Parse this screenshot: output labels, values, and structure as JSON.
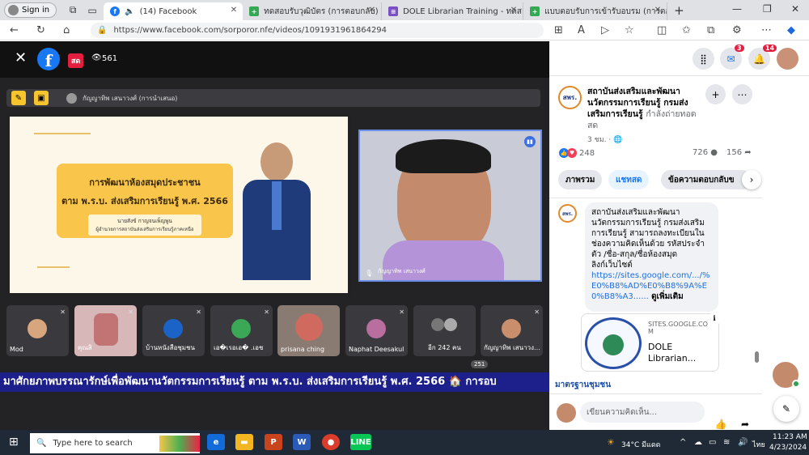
{
  "browser": {
    "signin_label": "Sign in",
    "tabs": [
      {
        "title": "(14) Facebook",
        "active": true
      },
      {
        "title": "ทดสอบรับวุฒิบัตร (การตอบกลับ) - Goo"
      },
      {
        "title": "DOLE Librarian Training - ทดสอบ"
      },
      {
        "title": "แบบตอบรับการเข้ารับอบรม (การตอบ"
      }
    ],
    "new_tab": "+",
    "url": "https://www.facebook.com/sorporor.nfe/videos/1091931961864294"
  },
  "video": {
    "live_badge": "สด",
    "viewers": "561",
    "presenter_bar": "กัญญาทิพ เสนาวงศ์ (การนำเสนอ)",
    "slide": {
      "title_line1": "การพัฒนาห้องสมุดประชาชน",
      "title_line2": "ตาม พ.ร.บ. ส่งเสริมการเรียนรู้ พ.ศ. 2566",
      "speaker_name": "นายสังข์ กาญจนเพ็ญพูน",
      "speaker_role": "ผู้อำนวยการสถาบันส่งเสริมการเรียนรู้ภาคเหนือ"
    },
    "speaker_label": "กัญญาทิพ เสนาวงศ์",
    "participants": [
      {
        "name": "Mod"
      },
      {
        "name": "คุณสิ"
      },
      {
        "name": "บ้านหนังสือชุมชน"
      },
      {
        "name": "เอ�เรอเอ� .เอช"
      },
      {
        "name": "prisana ching"
      },
      {
        "name": "Naphat Deesakul"
      },
      {
        "name": "อีก 242 คน"
      },
      {
        "name": "กัญญาทิพ เสนาวง..."
      }
    ],
    "participant_count": "251",
    "ticker": "มาศักยภาพบรรณารักษ์เพื่อพัฒนานวัตกรรมการเรียนรู้ ตาม พ.ร.บ. ส่งเสริมการเรียนรู้ พ.ศ. 2566   🏠 การอบ"
  },
  "header": {
    "messenger_badge": "3",
    "notif_badge": "14"
  },
  "post": {
    "page_logo": "สพร.",
    "page_name": "สถาบันส่งเสริมและพัฒนานวัตกรรมการเรียนรู้ กรมส่งเสริมการเรียนรู้",
    "status": "กำลังถ่ายทอดสด",
    "time": "3 ชม.",
    "reactions": "248",
    "comments": "726",
    "shares": "156",
    "tabs": [
      "ภาพรวม",
      "แชทสด",
      "ข้อความตอบกลับข"
    ],
    "comment": {
      "text": "สถาบันส่งเสริมและพัฒนานวัตกรรมการเรียนรู้ กรมส่งเสริมการเรียนรู้ สามารถลงทะเบียนในช่องความคิดเห็นด้วย รหัสประจำตัว /ชื่อ-สกุล/ชื่อห้องสมุด",
      "link_intro": "ลิงก์เว็บไซต์",
      "link": "https://sites.google.com/.../%E0%B8%AD%E0%B8%9A%E0%B8%A3......",
      "see_more": "ดูเพิ่มเติม"
    },
    "link_card": {
      "domain": "SITES.GOOGLE.COM",
      "title": "DOLE Librarian..."
    },
    "next_commenter": "มาตรฐานชุมชน",
    "chat_placeholder": "เขียนความคิดเห็น..."
  },
  "taskbar": {
    "search_placeholder": "Type here to search",
    "weather": "34°C  มีแดด",
    "lang": "ไทย",
    "time": "11:23 AM",
    "date": "4/23/2024"
  }
}
